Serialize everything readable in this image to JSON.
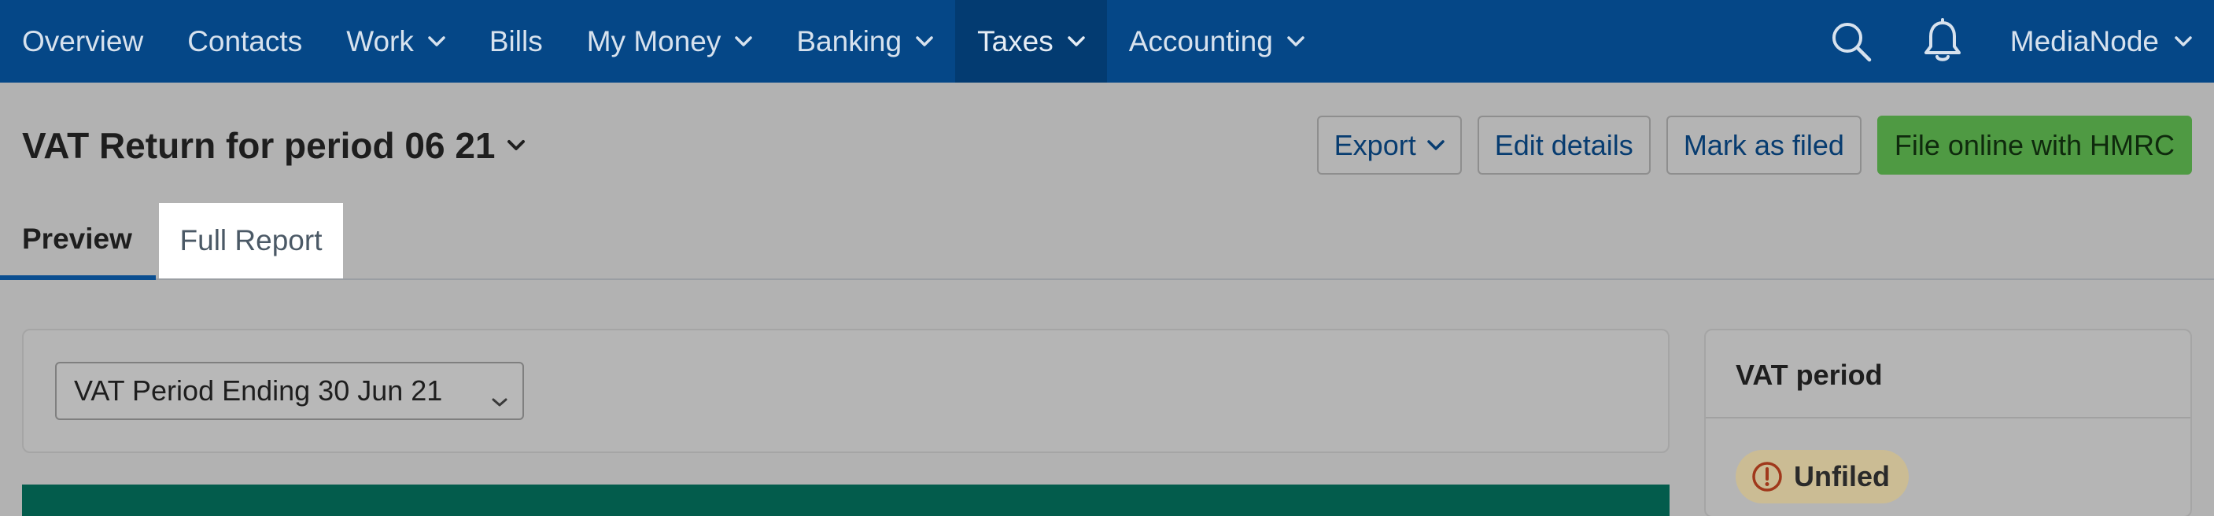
{
  "nav": {
    "items": [
      {
        "label": "Overview",
        "has_dropdown": false,
        "active": false
      },
      {
        "label": "Contacts",
        "has_dropdown": false,
        "active": false
      },
      {
        "label": "Work",
        "has_dropdown": true,
        "active": false
      },
      {
        "label": "Bills",
        "has_dropdown": false,
        "active": false
      },
      {
        "label": "My Money",
        "has_dropdown": true,
        "active": false
      },
      {
        "label": "Banking",
        "has_dropdown": true,
        "active": false
      },
      {
        "label": "Taxes",
        "has_dropdown": true,
        "active": true
      },
      {
        "label": "Accounting",
        "has_dropdown": true,
        "active": false
      }
    ],
    "search_icon": "search-icon",
    "notifications_icon": "bell-icon",
    "account_label": "MediaNode"
  },
  "header": {
    "title": "VAT Return for period 06 21",
    "actions": {
      "export_label": "Export",
      "edit_label": "Edit details",
      "mark_filed_label": "Mark as filed",
      "file_online_label": "File online with HMRC"
    }
  },
  "tabs": {
    "preview_label": "Preview",
    "full_report_label": "Full Report",
    "active": "Preview"
  },
  "period_select": {
    "value": "VAT Period Ending 30 Jun 21"
  },
  "side": {
    "title": "VAT period",
    "status": "Unfiled",
    "status_icon": "warning-icon"
  },
  "colors": {
    "nav_bg": "#054787",
    "primary_button": "#4f9a43",
    "tab_underline": "#0a4e90",
    "green_banner": "#035c4c",
    "status_badge": "#cbbc94"
  }
}
